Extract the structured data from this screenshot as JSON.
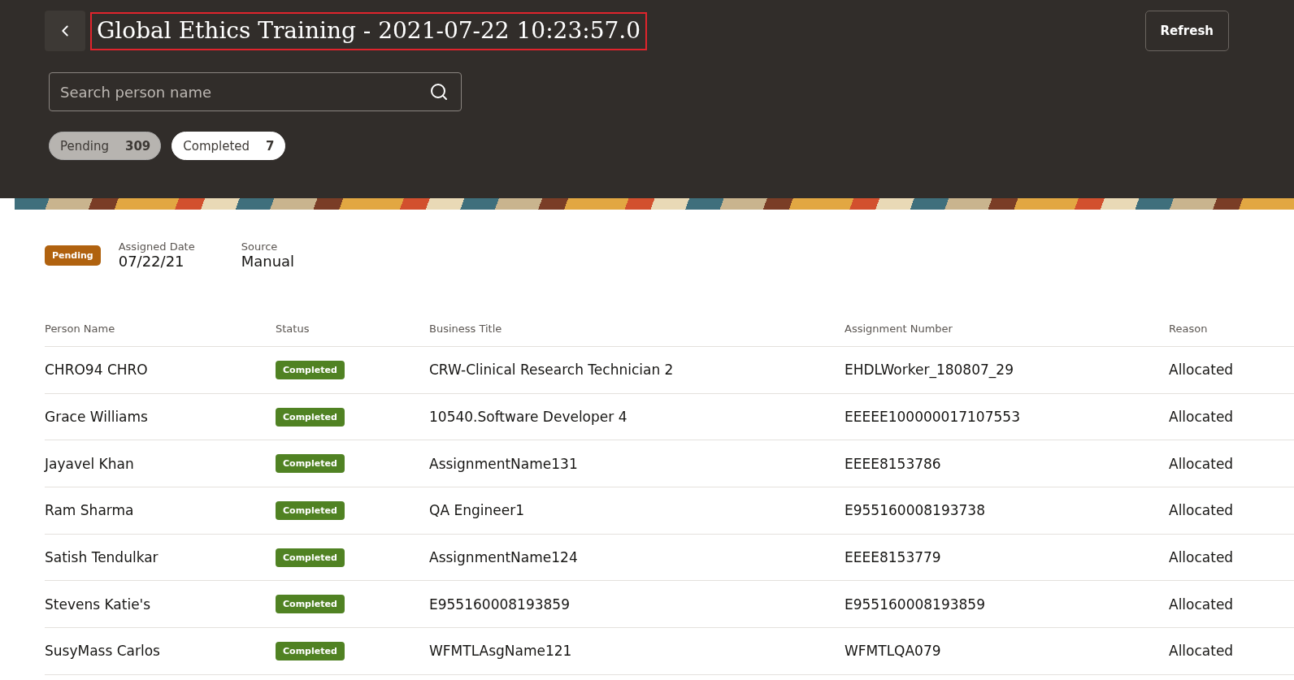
{
  "header": {
    "title": "Global Ethics Training - 2021-07-22 10:23:57.0",
    "refresh": "Refresh",
    "search": {
      "placeholder": "Search person name"
    },
    "filters": [
      {
        "label": "Pending",
        "count": "309",
        "selected": false
      },
      {
        "label": "Completed",
        "count": "7",
        "selected": true
      }
    ]
  },
  "summary": {
    "status": "Pending",
    "fields": [
      {
        "label": "Assigned Date",
        "value": "07/22/21"
      },
      {
        "label": "Source",
        "value": "Manual"
      }
    ]
  },
  "table": {
    "columns": [
      "Person Name",
      "Status",
      "Business Title",
      "Assignment Number",
      "Reason"
    ],
    "rows": [
      {
        "name": "CHRO94 CHRO",
        "status": "Completed",
        "title": "CRW-Clinical Research Technician 2",
        "assignment": "EHDLWorker_180807_29",
        "reason": "Allocated"
      },
      {
        "name": "Grace Williams",
        "status": "Completed",
        "title": "10540.Software Developer 4",
        "assignment": "EEEEE100000017107553",
        "reason": "Allocated"
      },
      {
        "name": "Jayavel Khan",
        "status": "Completed",
        "title": "AssignmentName131",
        "assignment": "EEEE8153786",
        "reason": "Allocated"
      },
      {
        "name": "Ram Sharma",
        "status": "Completed",
        "title": "QA Engineer1",
        "assignment": "E955160008193738",
        "reason": "Allocated"
      },
      {
        "name": "Satish Tendulkar",
        "status": "Completed",
        "title": "AssignmentName124",
        "assignment": "EEEE8153779",
        "reason": "Allocated"
      },
      {
        "name": "Stevens Katie's",
        "status": "Completed",
        "title": "E955160008193859",
        "assignment": "E955160008193859",
        "reason": "Allocated"
      },
      {
        "name": "SusyMass Carlos",
        "status": "Completed",
        "title": "WFMTLAsgName121",
        "assignment": "WFMTLQA079",
        "reason": "Allocated"
      }
    ]
  }
}
